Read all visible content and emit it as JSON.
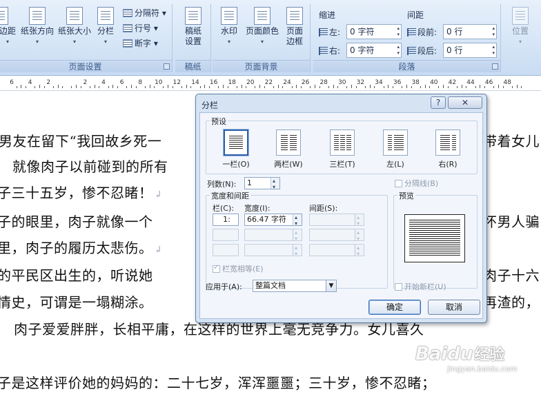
{
  "ribbon": {
    "page_setup": {
      "margins": "边距",
      "orientation": "纸张方向",
      "size": "纸张大小",
      "columns": "分栏",
      "breaks": "分隔符",
      "line_numbers": "行号",
      "hyphenation": "断字",
      "group_label": "页面设置"
    },
    "draft": {
      "settings_line1": "稿纸",
      "settings_line2": "设置",
      "group_label": "稿纸"
    },
    "page_background": {
      "watermark": "水印",
      "page_color": "页面颜色",
      "page_border_line1": "页面",
      "page_border_line2": "边框",
      "group_label": "页面背景"
    },
    "paragraph": {
      "indent_header": "缩进",
      "spacing_header": "间距",
      "indent_left_label": "左:",
      "indent_left_value": "0 字符",
      "indent_right_label": "右:",
      "indent_right_value": "0 字符",
      "spacing_before_label": "段前:",
      "spacing_before_value": "0 行",
      "spacing_after_label": "段后:",
      "spacing_after_value": "0 行",
      "group_label": "段落"
    },
    "arrange": {
      "position": "位置"
    }
  },
  "ruler": {
    "numbers": [
      "6",
      "4",
      "2",
      "",
      "2",
      "4",
      "6",
      "8",
      "10",
      "12",
      "14",
      "16",
      "18",
      "20",
      "22",
      "24",
      "26",
      "28",
      "30",
      "32",
      "34",
      "36",
      "38",
      "40",
      "42",
      "44",
      "46",
      "48"
    ]
  },
  "document": {
    "lines": [
      "男友在留下“我回故乡死一",
      "就像肉子以前碰到的所有",
      "子三十五岁，惨不忍睹！",
      "子的眼里，肉子就像一个",
      "里，肉子的履历太悲伤。",
      "的平民区出生的，听说她",
      "情史，可谓是一塌糊涂。",
      "肉子爱爱胖胖，长相平庸，在这样的世界上毫无竞争力。女儿喜久",
      "子是这样评价她的妈妈的：二十七岁，浑浑噩噩；三十岁，惨不忍睹；"
    ],
    "right_lines": [
      "带着女儿",
      "怀男人骗",
      "肉子十六",
      "再渣的，"
    ],
    "para_mark": "↲"
  },
  "watermark": {
    "brand": "Baidu",
    "cn": "经验",
    "url": "jingyan.baidu.com"
  },
  "dialog": {
    "title": "分栏",
    "help": "?",
    "close": "✕",
    "presets_label": "预设",
    "presets": [
      {
        "label": "一栏(O)",
        "columns": 1,
        "selected": true
      },
      {
        "label": "两栏(W)",
        "columns": 2,
        "selected": false
      },
      {
        "label": "三栏(T)",
        "columns": 3,
        "selected": false
      },
      {
        "label": "左(L)",
        "columns": 2,
        "selected": false
      },
      {
        "label": "右(R)",
        "columns": 2,
        "selected": false
      }
    ],
    "num_columns_label": "列数(N):",
    "num_columns_value": "1",
    "separator_label": "分隔线(B)",
    "width_spacing_label": "宽度和间距",
    "col_header": "栏(C):",
    "width_header": "宽度(I):",
    "spacing_header": "间距(S):",
    "row1_col": "1:",
    "row1_width": "66.47 字符",
    "equal_width_label": "栏宽相等(E)",
    "preview_label": "预览",
    "apply_to_label": "应用于(A):",
    "apply_to_value": "整篇文档",
    "start_new_column_label": "开始新栏(U)",
    "ok": "确定",
    "cancel": "取消"
  }
}
